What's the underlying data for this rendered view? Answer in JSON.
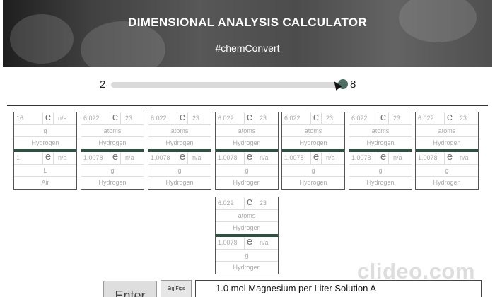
{
  "header": {
    "title": "DIMENSIONAL ANALYSIS CALCULATOR",
    "subtitle": "#chemConvert"
  },
  "slider": {
    "min_label": "2",
    "max_label": "8",
    "value": 8
  },
  "e_symbol": "e",
  "cards": [
    {
      "top": {
        "coefficient": "16",
        "exponent": "n/a",
        "unit": "g",
        "substance": "Hydrogen"
      },
      "bottom": {
        "coefficient": "1",
        "exponent": "n/a",
        "unit": "L",
        "substance": "Air"
      }
    },
    {
      "top": {
        "coefficient": "6.022",
        "exponent": "23",
        "unit": "atoms",
        "substance": "Hydrogen"
      },
      "bottom": {
        "coefficient": "1.0078",
        "exponent": "n/a",
        "unit": "g",
        "substance": "Hydrogen"
      }
    },
    {
      "top": {
        "coefficient": "6.022",
        "exponent": "23",
        "unit": "atoms",
        "substance": "Hydrogen"
      },
      "bottom": {
        "coefficient": "1.0078",
        "exponent": "n/a",
        "unit": "g",
        "substance": "Hydrogen"
      }
    },
    {
      "top": {
        "coefficient": "6.022",
        "exponent": "23",
        "unit": "atoms",
        "substance": "Hydrogen"
      },
      "bottom": {
        "coefficient": "1.0078",
        "exponent": "n/a",
        "unit": "g",
        "substance": "Hydrogen"
      }
    },
    {
      "top": {
        "coefficient": "6.022",
        "exponent": "23",
        "unit": "atoms",
        "substance": "Hydrogen"
      },
      "bottom": {
        "coefficient": "1.0078",
        "exponent": "n/a",
        "unit": "g",
        "substance": "Hydrogen"
      }
    },
    {
      "top": {
        "coefficient": "6.022",
        "exponent": "23",
        "unit": "atoms",
        "substance": "Hydrogen"
      },
      "bottom": {
        "coefficient": "1.0078",
        "exponent": "n/a",
        "unit": "g",
        "substance": "Hydrogen"
      }
    },
    {
      "top": {
        "coefficient": "6.022",
        "exponent": "23",
        "unit": "atoms",
        "substance": "Hydrogen"
      },
      "bottom": {
        "coefficient": "1.0078",
        "exponent": "n/a",
        "unit": "g",
        "substance": "Hydrogen"
      }
    },
    {
      "top": {
        "coefficient": "6.022",
        "exponent": "23",
        "unit": "atoms",
        "substance": "Hydrogen"
      },
      "bottom": {
        "coefficient": "1.0078",
        "exponent": "n/a",
        "unit": "g",
        "substance": "Hydrogen"
      }
    }
  ],
  "controls": {
    "enter_label": "Enter",
    "sigfigs_label": "Sig Figs",
    "solution_text": "1.0 mol Magnesium per Liter Solution A"
  },
  "watermark": "clideo.com",
  "colors": {
    "accent": "#4e6e63",
    "separator": "#2f4f43"
  }
}
